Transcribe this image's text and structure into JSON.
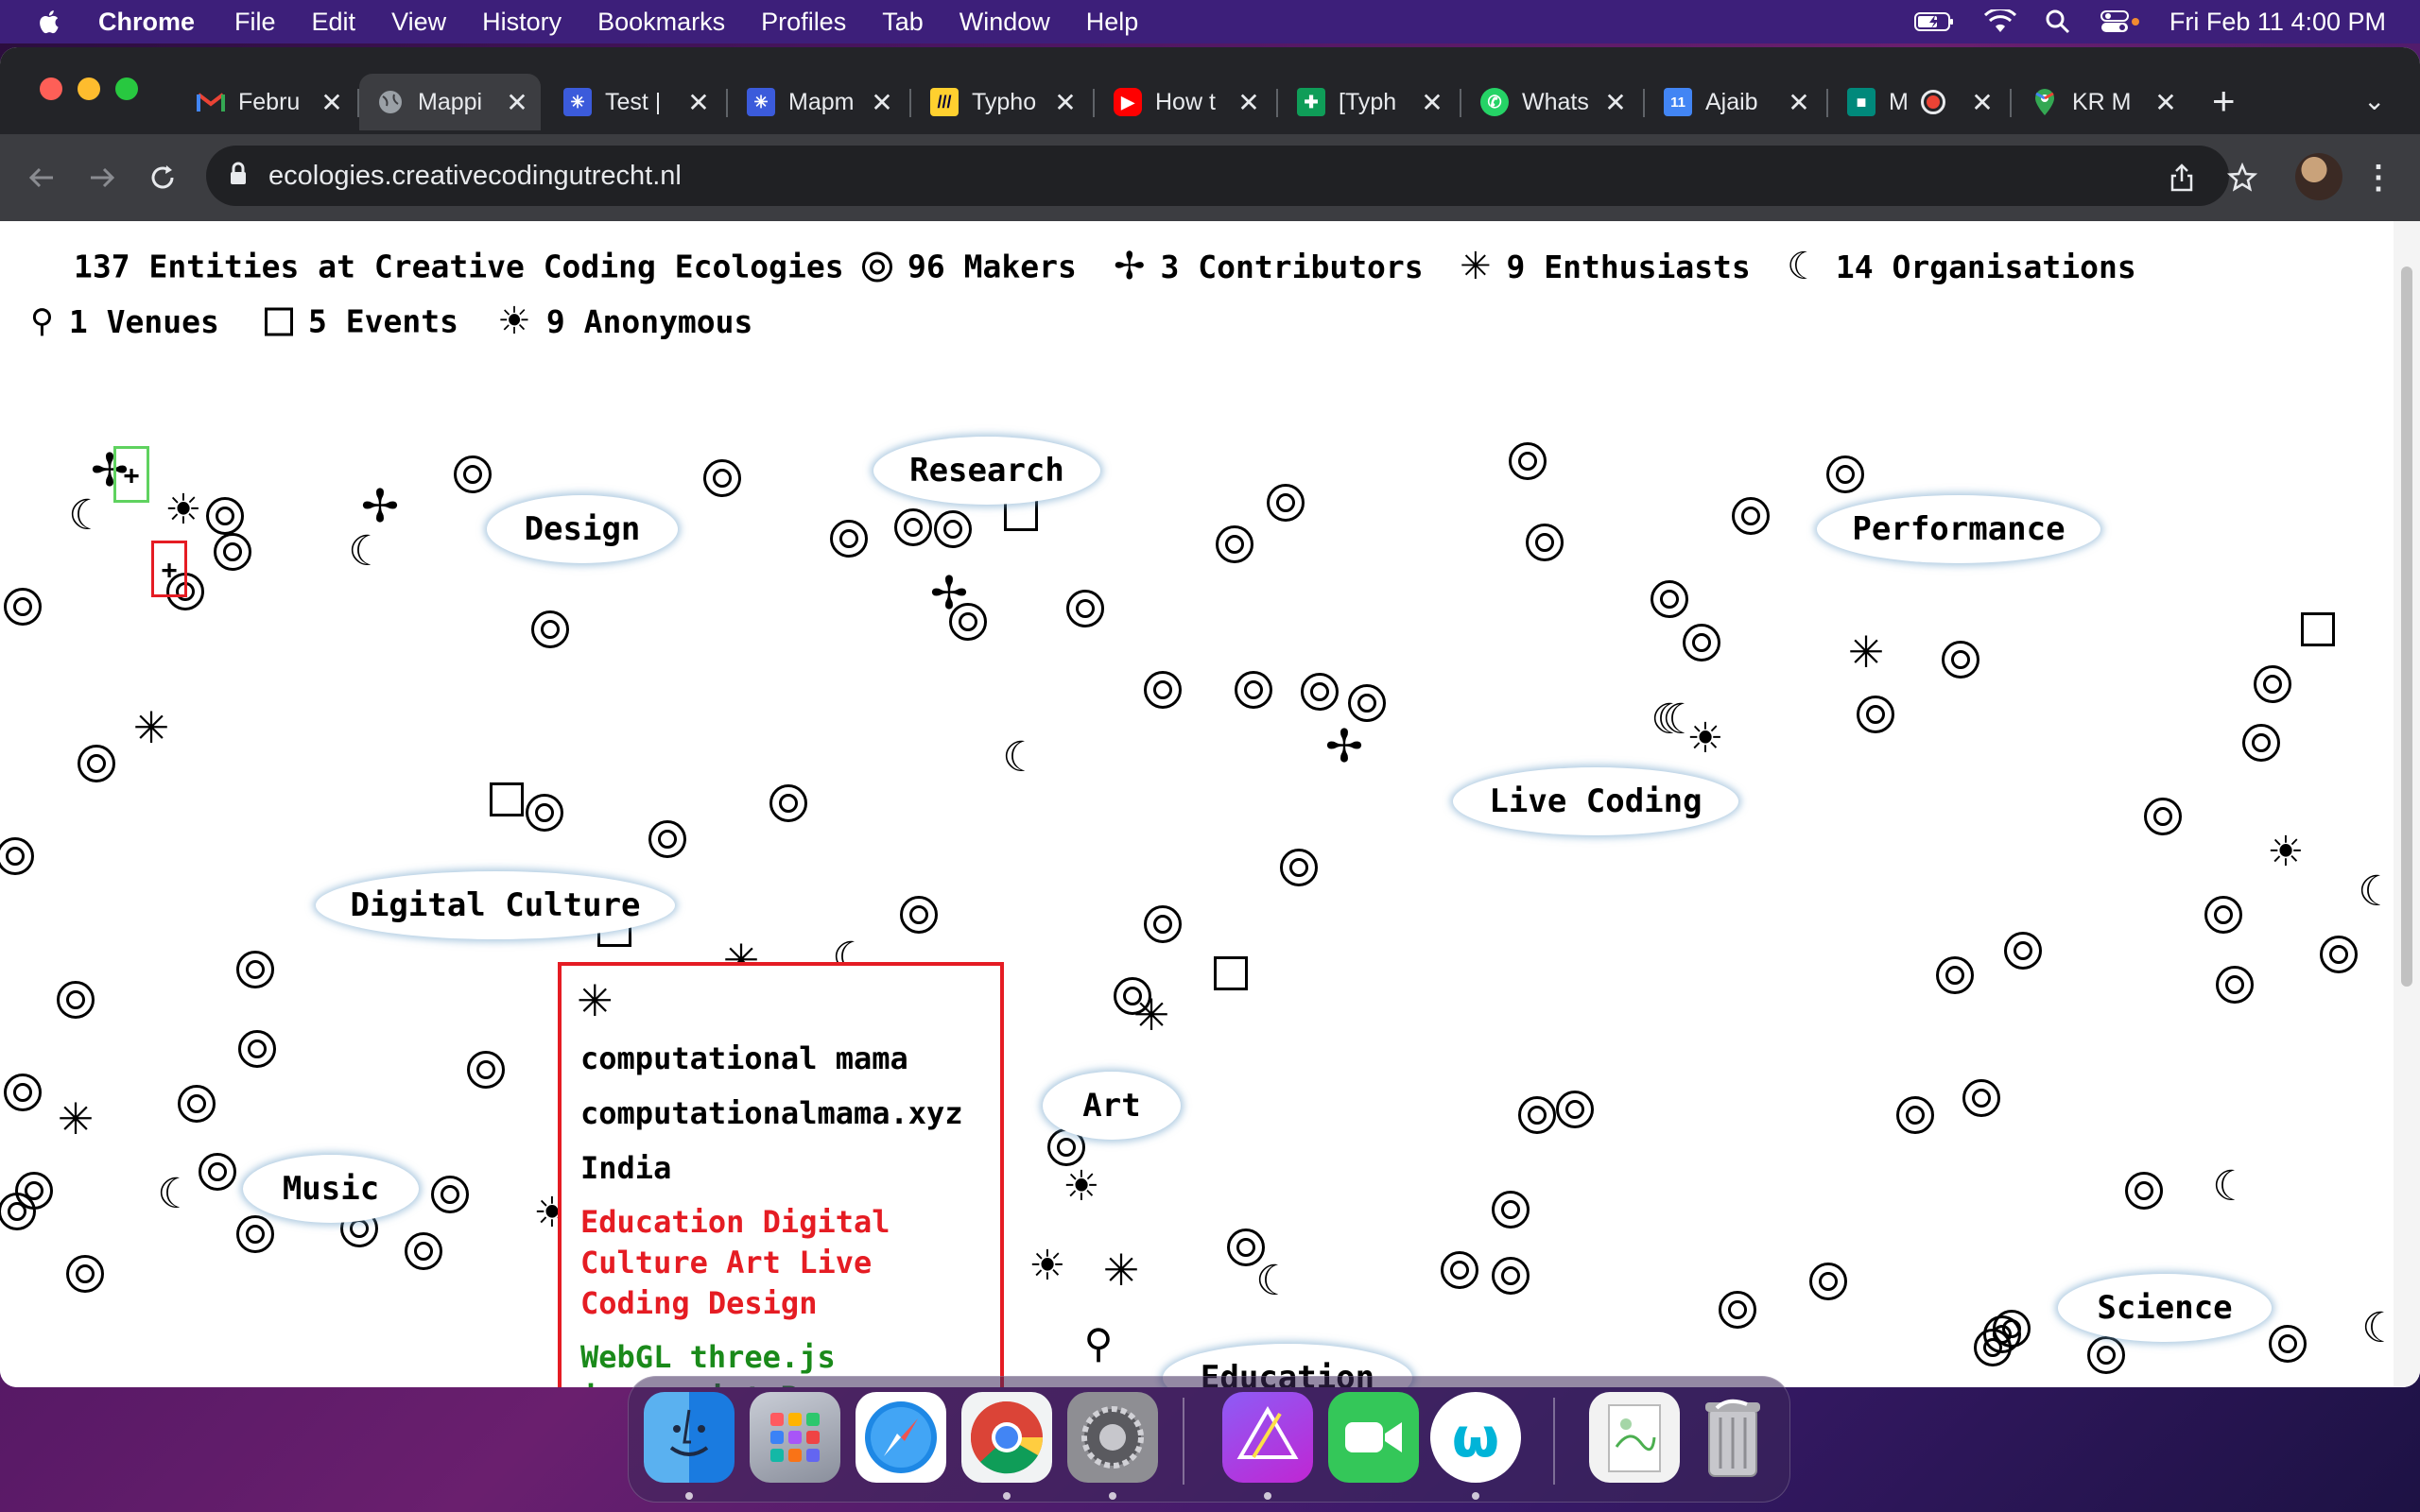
{
  "menubar": {
    "app_name": "Chrome",
    "items": [
      "File",
      "Edit",
      "View",
      "History",
      "Bookmarks",
      "Profiles",
      "Tab",
      "Window",
      "Help"
    ],
    "clock": "Fri Feb 11  4:00 PM"
  },
  "tabs": [
    {
      "title": "Febru",
      "icon": "gmail-icon",
      "color": "#ea4335"
    },
    {
      "title": "Mappi",
      "icon": "globe-icon",
      "color": "#9aa0a6",
      "active": true
    },
    {
      "title": "Test |",
      "icon": "mapme-icon",
      "color": "#3b5bdb"
    },
    {
      "title": "Mapm",
      "icon": "mapme-icon",
      "color": "#3b5bdb"
    },
    {
      "title": "Typho",
      "icon": "miro-icon",
      "color": "#ffd02f"
    },
    {
      "title": "How t",
      "icon": "youtube-icon",
      "color": "#ff0000"
    },
    {
      "title": "[Typh",
      "icon": "sheets-icon",
      "color": "#0f9d58"
    },
    {
      "title": "Whats",
      "icon": "whatsapp-icon",
      "color": "#25d366"
    },
    {
      "title": "Ajaib",
      "icon": "calendar-icon",
      "color": "#4285f4"
    },
    {
      "title": "M",
      "icon": "meet-icon",
      "color": "#00897b"
    },
    {
      "title": "KR M",
      "icon": "maps-icon",
      "color": "#34a853"
    }
  ],
  "address_bar": {
    "url": "ecologies.creativecodingutrecht.nl"
  },
  "stats": {
    "total": "137 Entities at Creative Coding Ecologies",
    "makers": "96 Makers",
    "contributors": "3 Contributors",
    "enthusiasts": "9 Enthusiasts",
    "organisations": "14 Organisations",
    "venues": "1 Venues",
    "events": "5 Events",
    "anonymous": "9 Anonymous"
  },
  "topics": [
    "Research",
    "Design",
    "Performance",
    "Live Coding",
    "Digital Culture",
    "Art",
    "Music",
    "Education",
    "Science"
  ],
  "popup": {
    "type_icon": "enthusiast-icon",
    "name": "computational mama",
    "website": "computationalmama.xyz",
    "location": "India",
    "themes": "Education Digital Culture Art Live Coding Design",
    "tags": "WebGL three.js javascript Browser"
  },
  "colors": {
    "menubar": "#3d1f7a",
    "highlight_contributor": "#5fd25f",
    "highlight_selected": "#e51c23",
    "themes_text": "#e51c23",
    "tags_text": "#1a8a1a"
  },
  "dock": [
    "Finder",
    "Launchpad",
    "Safari",
    "Chrome",
    "System Preferences",
    "Affinity Photo",
    "FaceTime",
    "Webex",
    "Preview",
    "Trash"
  ]
}
